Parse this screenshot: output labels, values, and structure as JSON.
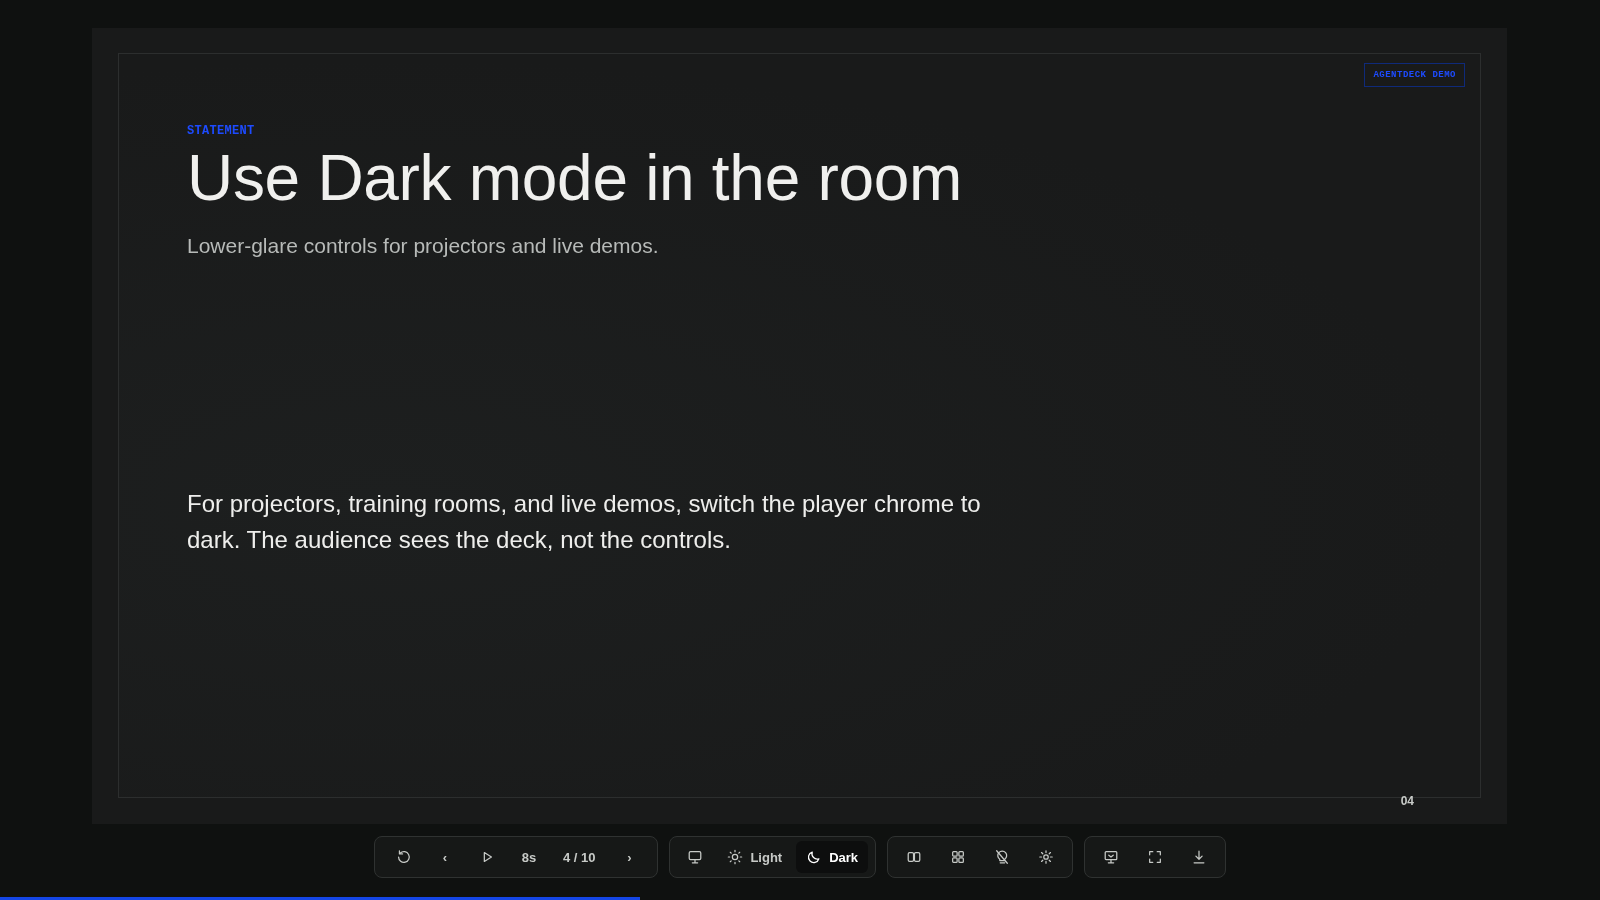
{
  "slide": {
    "badge": "AGENTDECK DEMO",
    "eyebrow": "STATEMENT",
    "title": "Use Dark mode in the room",
    "subtitle": "Lower-glare controls for projectors and live demos.",
    "body": "For projectors, training rooms, and live demos, switch the player chrome to dark. The audience sees the deck, not the controls.",
    "page_number": "04"
  },
  "toolbar": {
    "playback": [
      {
        "kind": "icon"
      },
      {
        "kind": "text",
        "label": "‹"
      },
      {
        "kind": "icon"
      },
      {
        "kind": "text",
        "label": "8s"
      },
      {
        "kind": "text",
        "label": "4 / 10"
      },
      {
        "kind": "text",
        "label": "›"
      }
    ],
    "theme": [
      {
        "selected": false
      },
      {
        "label": "Light",
        "selected": false
      },
      {
        "label": "Dark",
        "selected": true
      }
    ]
  },
  "progress": {
    "level": 0.4
  }
}
